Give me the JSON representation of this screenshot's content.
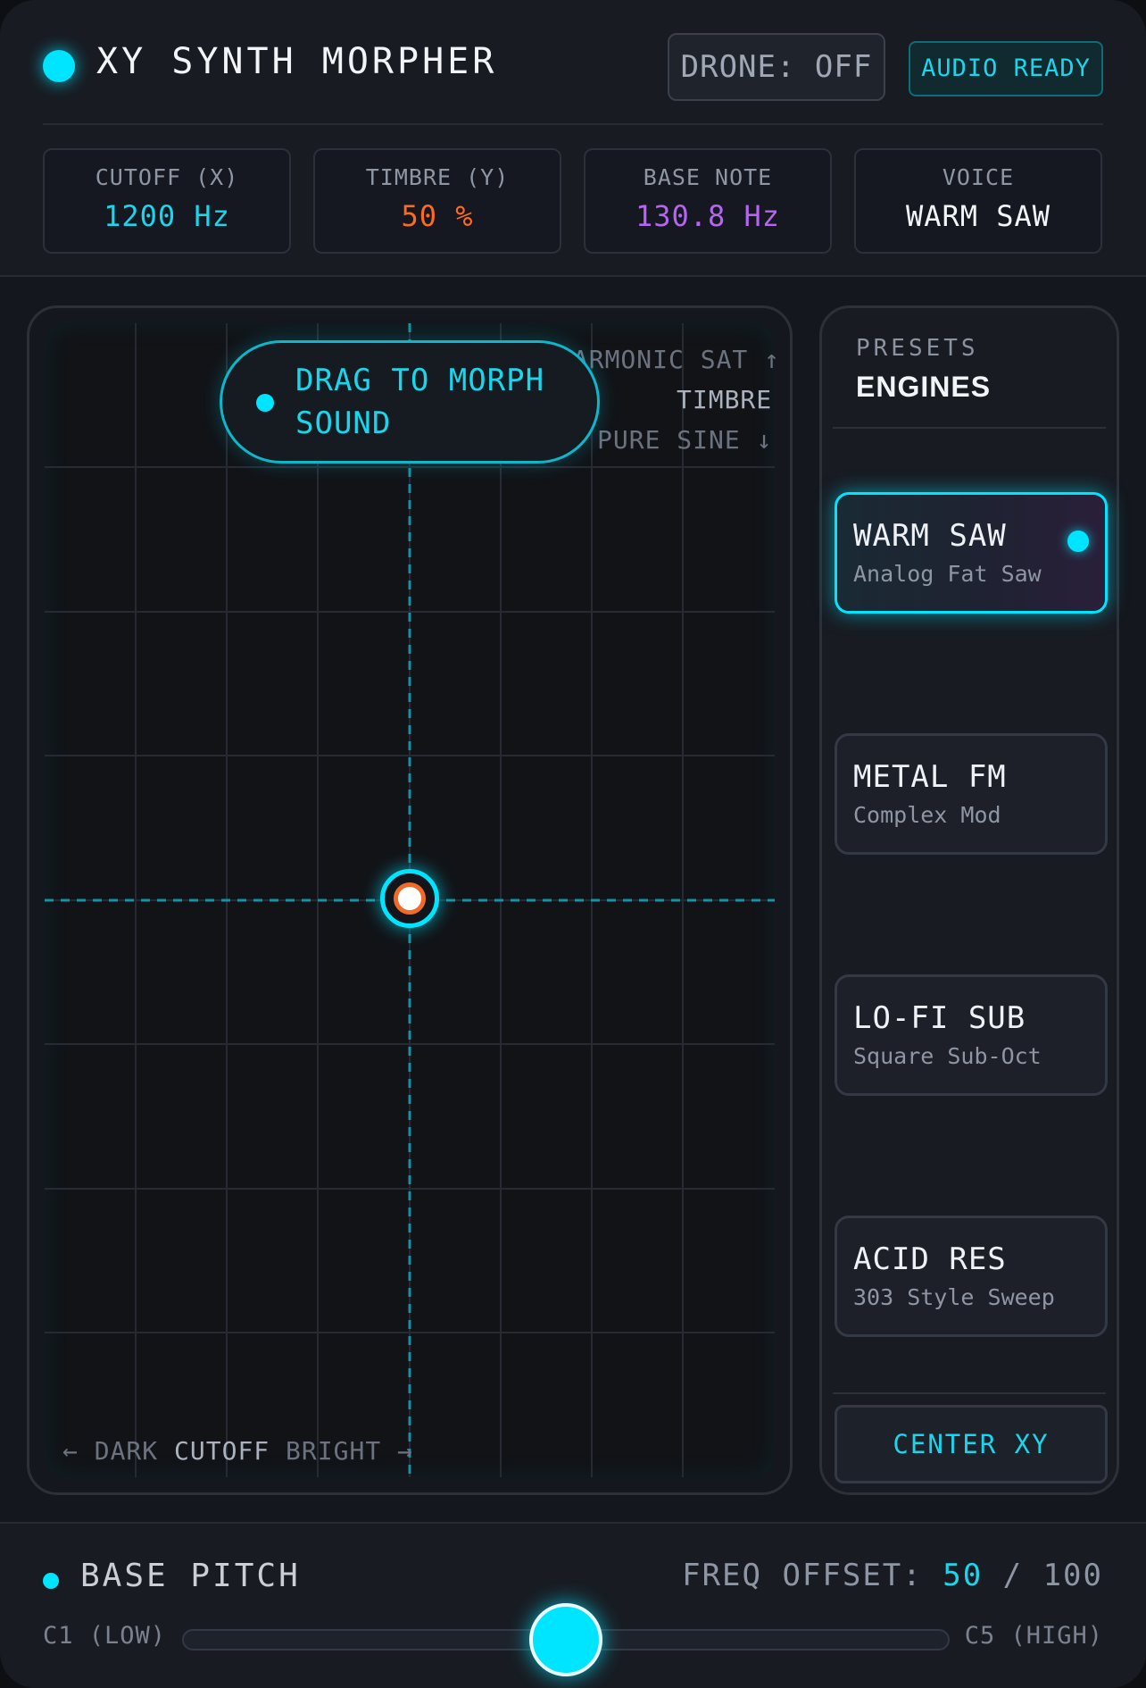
{
  "header": {
    "title": "XY SYNTH MORPHER",
    "drone_label": "DRONE: OFF",
    "audio_label": "AUDIO READY"
  },
  "stats": [
    {
      "label": "CUTOFF (X)",
      "value": "1200 Hz",
      "color": "#19d6ec"
    },
    {
      "label": "TIMBRE (Y)",
      "value": "50 %",
      "color": "#ff6a1f"
    },
    {
      "label": "BASE NOTE",
      "value": "130.8 Hz",
      "color": "#b565f0"
    },
    {
      "label": "VOICE",
      "value": "WARM SAW",
      "color": "#f2f4f7"
    }
  ],
  "pad": {
    "hint": "DRAG TO MORPH SOUND",
    "y_axis": {
      "top": "HARMONIC SAT ↑",
      "name": "TIMBRE",
      "bottom": "PURE SINE ↓"
    },
    "x_axis": {
      "left": "← DARK",
      "name": "CUTOFF",
      "right": "BRIGHT →"
    },
    "position": {
      "x": 0.5,
      "y": 0.5
    }
  },
  "presets": {
    "kicker": "PRESETS",
    "title": "ENGINES",
    "engines": [
      {
        "name": "WARM SAW",
        "sub": "Analog Fat Saw",
        "active": true
      },
      {
        "name": "METAL FM",
        "sub": "Complex Mod",
        "active": false
      },
      {
        "name": "LO-FI SUB",
        "sub": "Square Sub-Oct",
        "active": false
      },
      {
        "name": "ACID RES",
        "sub": "303 Style Sweep",
        "active": false
      }
    ],
    "center_label": "CENTER XY"
  },
  "footer": {
    "label": "BASE PITCH",
    "freq_prefix": "FREQ OFFSET: ",
    "freq_value": "50",
    "freq_suffix": " / 100",
    "range_low": "C1 (LOW)",
    "range_high": "C5 (HIGH)",
    "slider_value": 50,
    "slider_max": 100
  },
  "colors": {
    "accent": "#00e5ff",
    "orange": "#ff6a1f",
    "purple": "#b565f0"
  }
}
